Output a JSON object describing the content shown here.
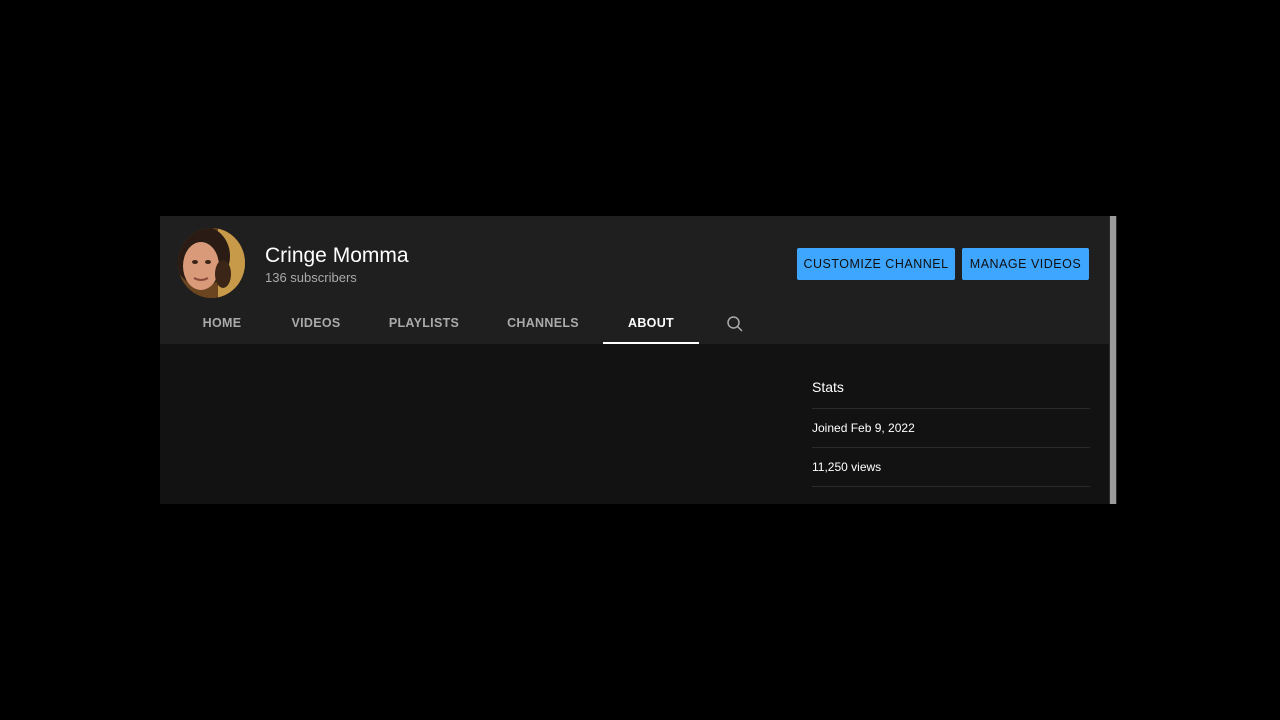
{
  "channel": {
    "name": "Cringe Momma",
    "subscribers": "136 subscribers"
  },
  "buttons": {
    "customize": "CUSTOMIZE CHANNEL",
    "manage": "MANAGE VIDEOS"
  },
  "tabs": [
    {
      "label": "HOME"
    },
    {
      "label": "VIDEOS"
    },
    {
      "label": "PLAYLISTS"
    },
    {
      "label": "CHANNELS"
    },
    {
      "label": "ABOUT",
      "active": true
    }
  ],
  "icons": {
    "tab_search": "search-icon"
  },
  "stats": {
    "title": "Stats",
    "joined": "Joined Feb 9, 2022",
    "views": "11,250 views"
  },
  "colors": {
    "accent": "#3ea6ff",
    "header_bg": "#1f1f1f",
    "body_bg": "#121212"
  }
}
